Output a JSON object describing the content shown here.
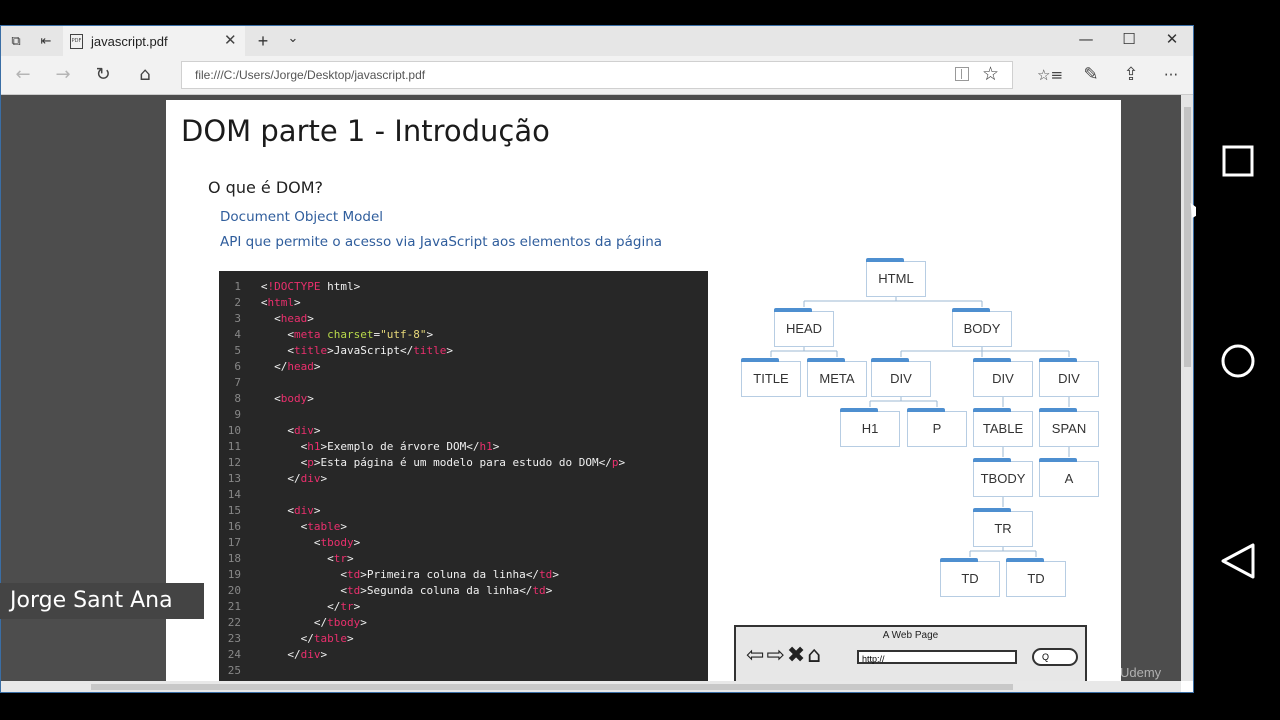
{
  "browser": {
    "tab_title": "javascript.pdf",
    "pdf_icon_label": "PDF",
    "new_tab": "+",
    "tab_list": "⌄",
    "close_tab": "✕",
    "minimize": "—",
    "maximize": "☐",
    "close": "✕",
    "back": "←",
    "forward": "→",
    "refresh": "↻",
    "home": "⌂",
    "address": "file:///C:/Users/Jorge/Desktop/javascript.pdf",
    "favorite": "☆",
    "favorites_list": "☆≡",
    "notes": "✎",
    "share": "⇪",
    "more": "···"
  },
  "slide": {
    "title": "DOM parte 1 - Introdução",
    "question": "O que é DOM?",
    "line1": "Document Object Model",
    "line2": "API que permite o acesso via JavaScript aos elementos da página"
  },
  "code_lines": [
    {
      "n": "1",
      "t": "<!DOCTYPE html>"
    },
    {
      "n": "2",
      "t": "<html>"
    },
    {
      "n": "3",
      "t": "  <head>"
    },
    {
      "n": "4",
      "t": "    <meta charset=\"utf-8\">"
    },
    {
      "n": "5",
      "t": "    <title>JavaScript</title>"
    },
    {
      "n": "6",
      "t": "  </head>"
    },
    {
      "n": "7",
      "t": ""
    },
    {
      "n": "8",
      "t": "  <body>"
    },
    {
      "n": "9",
      "t": ""
    },
    {
      "n": "10",
      "t": "    <div>"
    },
    {
      "n": "11",
      "t": "      <h1>Exemplo de árvore DOM</h1>"
    },
    {
      "n": "12",
      "t": "      <p>Esta página é um modelo para estudo do DOM</p>"
    },
    {
      "n": "13",
      "t": "    </div>"
    },
    {
      "n": "14",
      "t": ""
    },
    {
      "n": "15",
      "t": "    <div>"
    },
    {
      "n": "16",
      "t": "      <table>"
    },
    {
      "n": "17",
      "t": "        <tbody>"
    },
    {
      "n": "18",
      "t": "          <tr>"
    },
    {
      "n": "19",
      "t": "            <td>Primeira coluna da linha</td>"
    },
    {
      "n": "20",
      "t": "            <td>Segunda coluna da linha</td>"
    },
    {
      "n": "21",
      "t": "          </tr>"
    },
    {
      "n": "22",
      "t": "        </tbody>"
    },
    {
      "n": "23",
      "t": "      </table>"
    },
    {
      "n": "24",
      "t": "    </div>"
    },
    {
      "n": "25",
      "t": ""
    }
  ],
  "tree_nodes": {
    "html": "HTML",
    "head": "HEAD",
    "body": "BODY",
    "title": "TITLE",
    "meta": "META",
    "div1": "DIV",
    "div2": "DIV",
    "div3": "DIV",
    "h1": "H1",
    "p": "P",
    "table": "TABLE",
    "span": "SPAN",
    "tbody": "TBODY",
    "a": "A",
    "tr": "TR",
    "td1": "TD",
    "td2": "TD"
  },
  "mockup": {
    "title": "A Web Page",
    "url": "http://",
    "search": "Q"
  },
  "watermark": "Udemy",
  "presenter": "Jorge Sant Ana",
  "colors": {
    "code_tag": "#ea2f6d",
    "code_attr": "#b8d94a",
    "code_string": "#e8d97a",
    "subtitle_blue": "#2f5d9c",
    "node_blue": "#4e8fd0"
  }
}
